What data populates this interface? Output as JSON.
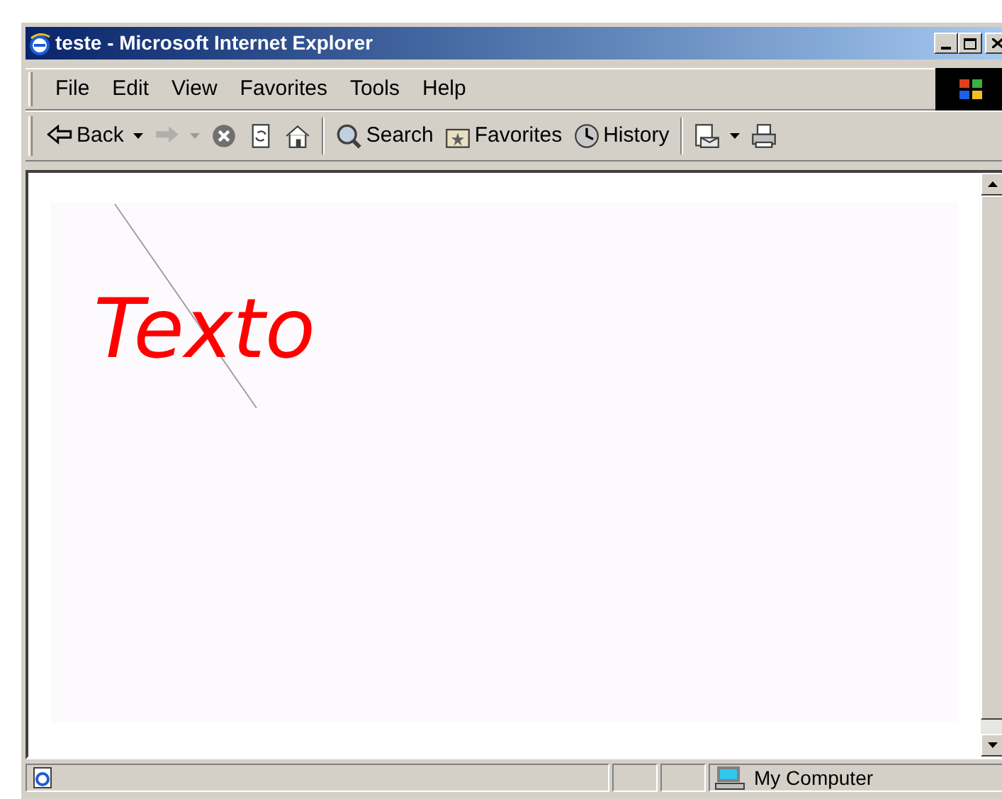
{
  "window": {
    "title": "teste - Microsoft Internet Explorer"
  },
  "menu": [
    {
      "label": "File"
    },
    {
      "label": "Edit"
    },
    {
      "label": "View"
    },
    {
      "label": "Favorites"
    },
    {
      "label": "Tools"
    },
    {
      "label": "Help"
    }
  ],
  "toolbar": [
    {
      "kind": "back",
      "label": "Back",
      "disabled": false,
      "dropdown": true
    },
    {
      "kind": "forward",
      "disabled": true,
      "dropdown": true
    },
    {
      "kind": "stop",
      "disabled": false
    },
    {
      "kind": "refresh",
      "disabled": false
    },
    {
      "kind": "home",
      "disabled": false
    },
    {
      "kind": "separator"
    },
    {
      "kind": "search",
      "label": "Search",
      "disabled": false
    },
    {
      "kind": "favorites",
      "label": "Favorites",
      "disabled": false
    },
    {
      "kind": "history",
      "label": "History",
      "disabled": false
    },
    {
      "kind": "separator"
    },
    {
      "kind": "mail",
      "disabled": false,
      "dropdown": true
    },
    {
      "kind": "print",
      "disabled": false
    }
  ],
  "document": {
    "text": "Texto"
  },
  "status_bar": {
    "zone": "My Computer"
  }
}
